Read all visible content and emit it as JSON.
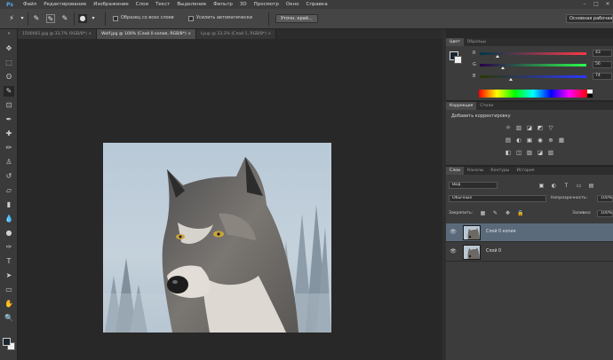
{
  "app": {
    "logo": "Ps"
  },
  "menu": {
    "items": [
      "Файл",
      "Редактирование",
      "Изображение",
      "Слои",
      "Текст",
      "Выделение",
      "Фильтр",
      "3D",
      "Просмотр",
      "Окно",
      "Справка"
    ],
    "window_controls": [
      "–",
      "□",
      "✕"
    ]
  },
  "options_bar": {
    "sample_all_layers": "Образец со всех слоев",
    "auto_enhance": "Усилить автоматически",
    "refine_edge": "Уточн. край...",
    "workspace": "Основная рабочая"
  },
  "document_tabs": [
    {
      "label": "1500001.jpg @ 33,7% (RGB/8*) ×",
      "active": false
    },
    {
      "label": "Wolf.jpg @ 100% (Слой 0 копия, RGB/8*) ×",
      "active": true
    },
    {
      "label": "Lyup @ 33,3% (Слой 1, RGB/8*) ×",
      "active": false
    }
  ],
  "color_panel": {
    "tabs": [
      {
        "label": "Цвет",
        "active": true
      },
      {
        "label": "Образцы",
        "active": false
      }
    ],
    "sliders": [
      {
        "label": "R",
        "value": "43",
        "position": 0.17,
        "gradient": "linear-gradient(to right,#00384a,#ff384a)"
      },
      {
        "label": "G",
        "value": "56",
        "position": 0.22,
        "gradient": "linear-gradient(to right,#2b004a,#2bff4a)"
      },
      {
        "label": "B",
        "value": "74",
        "position": 0.29,
        "gradient": "linear-gradient(to right,#2b3800,#2b38ff)"
      }
    ]
  },
  "adjustments_panel": {
    "tabs": [
      {
        "label": "Коррекция",
        "active": true
      },
      {
        "label": "Стили",
        "active": false
      }
    ],
    "title": "Добавить корректировку",
    "icons_row1": [
      "☼",
      "▥",
      "◪",
      "◩",
      "▽"
    ],
    "icons_row2": [
      "▤",
      "◐",
      "▣",
      "◉",
      "⊕",
      "▦"
    ],
    "icons_row3": [
      "◧",
      "◫",
      "▨",
      "◪",
      "▧"
    ]
  },
  "layers_panel": {
    "tabs": [
      {
        "label": "Слои",
        "active": true
      },
      {
        "label": "Каналы",
        "active": false
      },
      {
        "label": "Контуры",
        "active": false
      },
      {
        "label": "История",
        "active": false
      }
    ],
    "filter_kind": "Вид",
    "blend_mode": "Обычные",
    "opacity_label": "Непрозрачность:",
    "opacity_value": "100%",
    "lock_label": "Закрепить:",
    "fill_label": "Заливка:",
    "fill_value": "100%",
    "layers": [
      {
        "name": "Слой 0 копия",
        "selected": true
      },
      {
        "name": "Слой 0",
        "selected": false
      }
    ]
  }
}
